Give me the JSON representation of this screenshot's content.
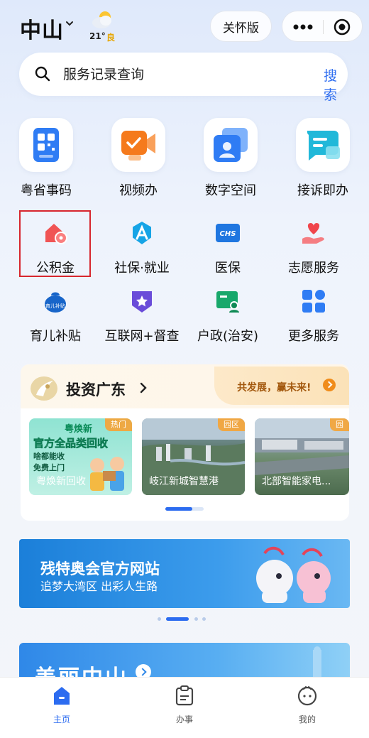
{
  "header": {
    "city": "中山",
    "temperature": "21°",
    "air_quality": "良",
    "care_mode_label": "关怀版"
  },
  "search": {
    "placeholder": "服务记录查询",
    "button_label": "搜索"
  },
  "primary_tiles": [
    {
      "label": "粤省事码",
      "icon": "qr-code-icon"
    },
    {
      "label": "视频办",
      "icon": "video-icon"
    },
    {
      "label": "数字空间",
      "icon": "digital-space-icon"
    },
    {
      "label": "接诉即办",
      "icon": "chat-icon"
    }
  ],
  "services": [
    {
      "label": "公积金",
      "icon": "housing-fund-icon",
      "highlighted": true
    },
    {
      "label": "社保·就业",
      "icon": "social-security-icon"
    },
    {
      "label": "医保",
      "icon": "medical-insurance-icon",
      "icon_text": "CHS"
    },
    {
      "label": "志愿服务",
      "icon": "volunteer-icon"
    },
    {
      "label": "育儿补贴",
      "icon": "childcare-subsidy-icon",
      "icon_text": "育儿补贴"
    },
    {
      "label": "互联网+督查",
      "icon": "internet-supervision-icon"
    },
    {
      "label": "户政(治安)",
      "icon": "household-registration-icon"
    },
    {
      "label": "更多服务",
      "icon": "more-services-icon"
    }
  ],
  "invest": {
    "title": "投资广东",
    "slogan": "共发展，赢未来!",
    "items": [
      {
        "badge": "热门",
        "caption": "粤焕新回收",
        "brand": "粤焕新",
        "headline": "官方全品类回收",
        "line1": "啥都能收",
        "line2": "免费上门"
      },
      {
        "badge": "园区",
        "caption": "岐江新城智慧港"
      },
      {
        "badge": "园",
        "caption": "北部智能家电..."
      }
    ]
  },
  "banner": {
    "title": "残特奥会官方网站",
    "subtitle": "追梦大湾区 出彩人生路"
  },
  "promo": {
    "title": "美丽中山"
  },
  "tabbar": [
    {
      "label": "主页",
      "icon": "home-icon",
      "active": true
    },
    {
      "label": "办事",
      "icon": "clipboard-icon",
      "active": false
    },
    {
      "label": "我的",
      "icon": "profile-icon",
      "active": false
    }
  ],
  "colors": {
    "accent": "#2c6cf0",
    "highlight_border": "#d7262e",
    "badge": "#f2a53c"
  }
}
